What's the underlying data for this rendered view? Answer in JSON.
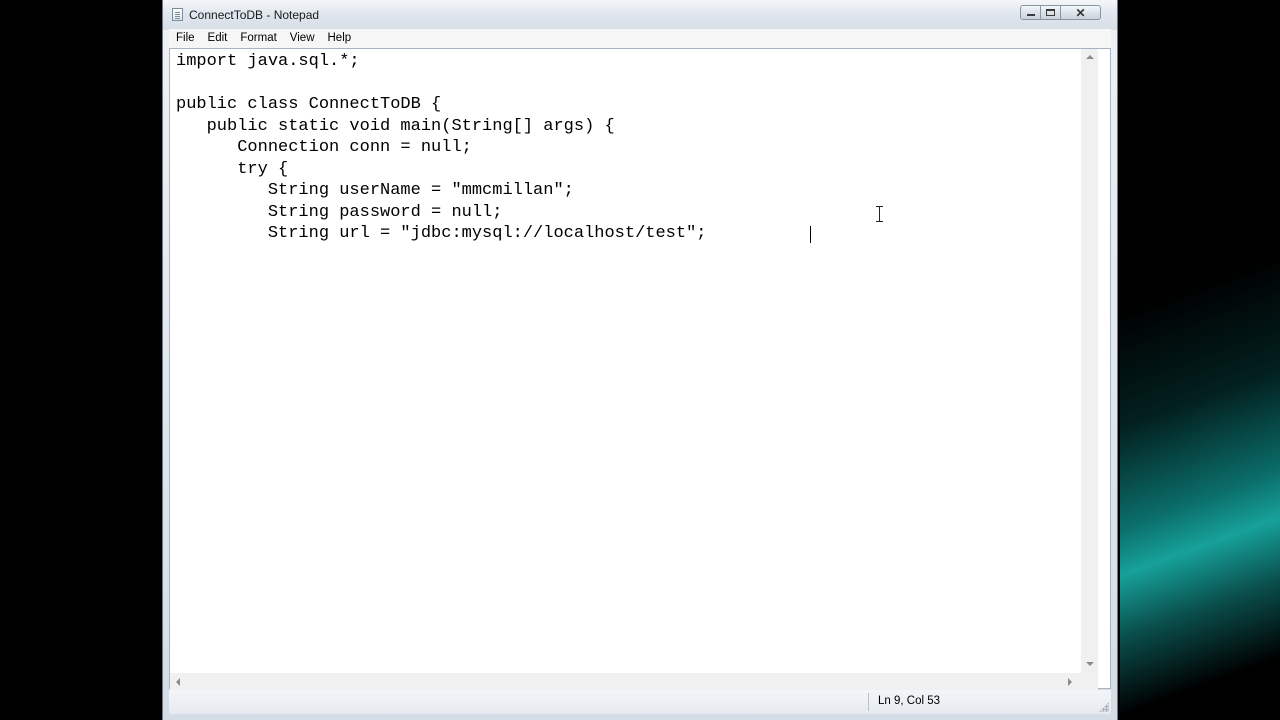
{
  "window": {
    "title": "ConnectToDB - Notepad"
  },
  "menu": [
    "File",
    "Edit",
    "Format",
    "View",
    "Help"
  ],
  "editor": {
    "lines": [
      "import java.sql.*;",
      "",
      "public class ConnectToDB {",
      "   public static void main(String[] args) {",
      "      Connection conn = null;",
      "      try {",
      "         String userName = \"mmcmillan\";",
      "         String password = null;",
      "         String url = \"jdbc:mysql://localhost/test\";"
    ]
  },
  "status": {
    "position": "Ln 9, Col 53"
  },
  "icons": {
    "app": "notepad-icon",
    "minimize": "minimize-icon",
    "maximize": "maximize-icon",
    "close": "close-icon",
    "cursor": "text-cursor-icon"
  }
}
